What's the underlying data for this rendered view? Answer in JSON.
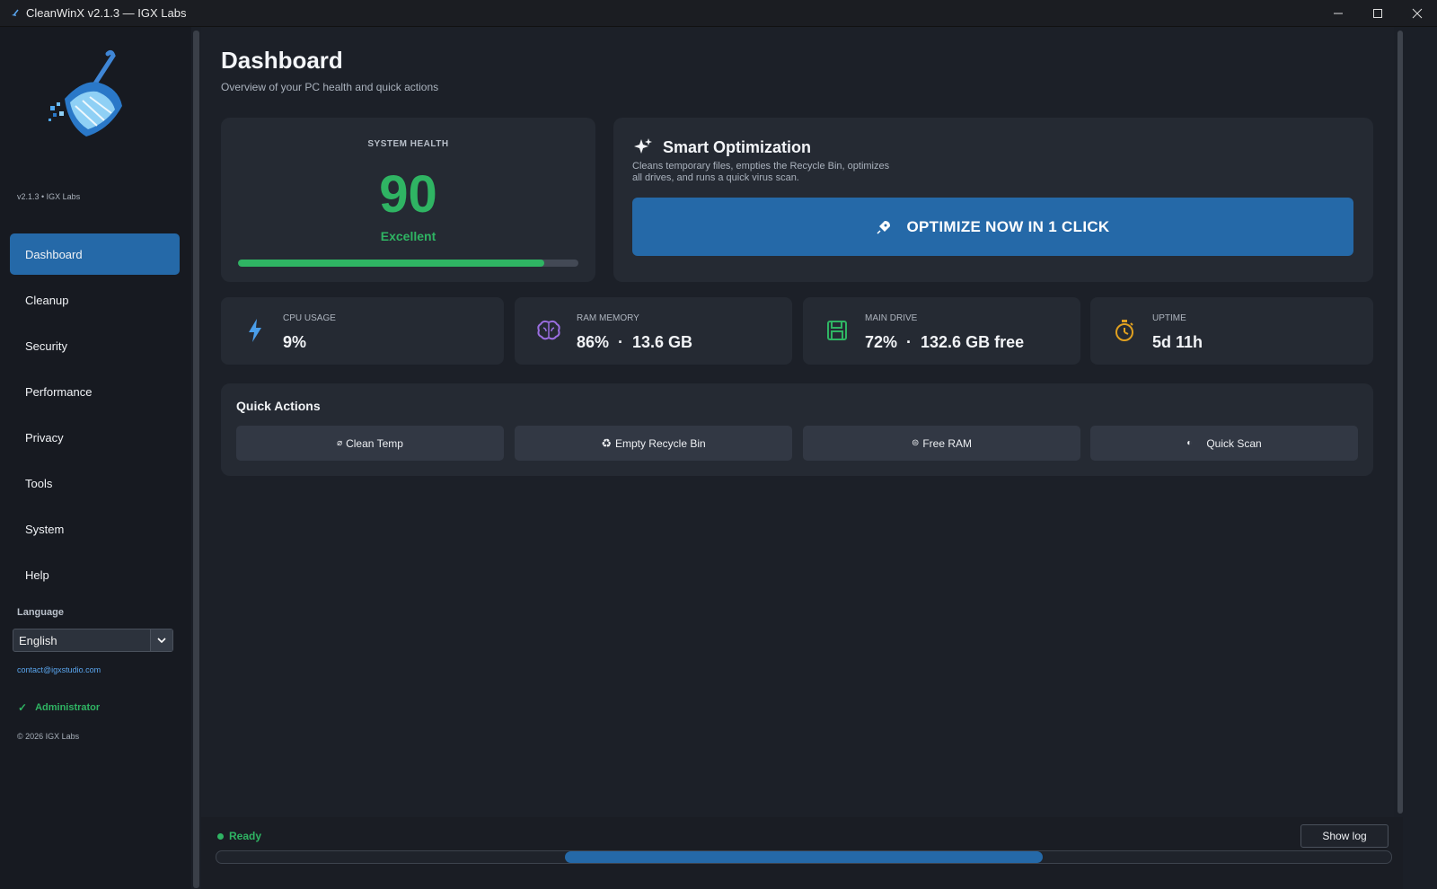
{
  "window": {
    "title": "CleanWinX v2.1.3 — IGX Labs",
    "minimize": "—",
    "maximize": "☐",
    "close": "✕"
  },
  "sidebar": {
    "version": "v2.1.3 • IGX Labs",
    "items": [
      {
        "label": "Dashboard",
        "active": true
      },
      {
        "label": "Cleanup"
      },
      {
        "label": "Security"
      },
      {
        "label": "Performance"
      },
      {
        "label": "Privacy"
      },
      {
        "label": "Tools"
      },
      {
        "label": "System"
      },
      {
        "label": "Help"
      }
    ],
    "language_label": "Language",
    "language_value": "English",
    "contact": "contact@igxstudio.com",
    "role_check": "✓",
    "role": "Administrator",
    "copyright": "© 2026 IGX Labs"
  },
  "main": {
    "title": "Dashboard",
    "subtitle": "Overview of your PC health and quick actions",
    "health": {
      "label": "SYSTEM HEALTH",
      "score": "90",
      "rating": "Excellent",
      "progress_fraction": 0.9
    },
    "smart": {
      "title": "Smart Optimization",
      "description": "Cleans temporary files, empties the Recycle Bin, optimizes all drives, and runs a quick virus scan.",
      "button": "OPTIMIZE NOW IN 1 CLICK"
    },
    "stats": [
      {
        "label": "CPU USAGE",
        "value": "9%",
        "icon": "lightning-icon",
        "color": "#4a9eea"
      },
      {
        "label": "RAM MEMORY",
        "value": "86%  ·  13.6 GB",
        "icon": "brain-icon",
        "color": "#9a6ee0"
      },
      {
        "label": "MAIN DRIVE",
        "value": "72%  ·  132.6 GB free",
        "icon": "floppy-disk-icon",
        "color": "#2fb463"
      },
      {
        "label": "UPTIME",
        "value": "5d 11h",
        "icon": "stopwatch-icon",
        "color": "#e0a020"
      }
    ],
    "quick_actions": {
      "title": "Quick Actions",
      "buttons": [
        {
          "label": "Clean Temp",
          "glyph": "⌀"
        },
        {
          "label": "Empty Recycle Bin",
          "glyph": "♻"
        },
        {
          "label": "Free RAM",
          "glyph": "⊜"
        },
        {
          "label": "Quick Scan",
          "glyph": "◐"
        }
      ]
    }
  },
  "status": {
    "text": "Ready",
    "show_log": "Show log",
    "progress_indeterminate": true
  },
  "colors": {
    "accent": "#2569a8",
    "success": "#2fb463",
    "background": "#1c2028",
    "card": "#252a33"
  }
}
